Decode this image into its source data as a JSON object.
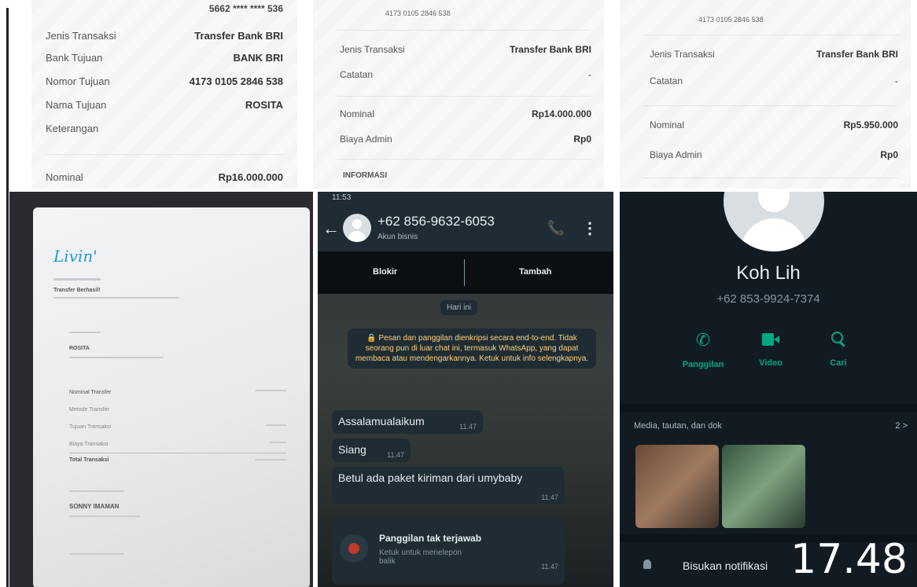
{
  "receipt1": {
    "card_number": "5662 **** **** 536",
    "rows": [
      {
        "label": "Jenis Transaksi",
        "value": "Transfer Bank BRI"
      },
      {
        "label": "Bank Tujuan",
        "value": "BANK BRI"
      },
      {
        "label": "Nomor Tujuan",
        "value": "4173 0105 2846 538"
      },
      {
        "label": "Nama Tujuan",
        "value": "ROSITA"
      },
      {
        "label": "Keterangan",
        "value": ""
      }
    ],
    "nominal_label": "Nominal",
    "nominal_value": "Rp16.000.000"
  },
  "receipt2": {
    "account": "4173 0105 2846 538",
    "jenis_label": "Jenis Transaksi",
    "jenis_value": "Transfer Bank BRI",
    "catatan_label": "Catatan",
    "catatan_value": "-",
    "nominal_label": "Nominal",
    "nominal_value": "Rp14.000.000",
    "admin_label": "Biaya Admin",
    "admin_value": "Rp0",
    "info_label": "INFORMASI"
  },
  "receipt3": {
    "account": "4173 0105 2846 538",
    "jenis_label": "Jenis Transaksi",
    "jenis_value": "Transfer Bank BRI",
    "catatan_label": "Catatan",
    "catatan_value": "-",
    "nominal_label": "Nominal",
    "nominal_value": "Rp5.950.000",
    "admin_label": "Biaya Admin",
    "admin_value": "Rp0"
  },
  "photo": {
    "app_logo": "Livin'",
    "status": "Transfer Berhasil!",
    "recipient": "ROSITA",
    "items": [
      "Nominal Transfer",
      "Metode Transfer",
      "Tujuan Transaksi",
      "Biaya Transaksi",
      "Total Transaksi"
    ],
    "source_name": "SONNY IMAMAN"
  },
  "chat": {
    "status_time": "11:53",
    "phone": "+62 856-9632-6053",
    "subtitle": "Akun bisnis",
    "block_label": "Blokir",
    "add_label": "Tambah",
    "date_chip": "Hari ini",
    "encryption_notice": "🔒 Pesan dan panggilan dienkripsi secara end-to-end. Tidak seorang pun di luar chat ini, termasuk WhatsApp, yang dapat membaca atau mendengarkannya. Ketuk untuk info selengkapnya.",
    "messages": [
      {
        "text": "Assalamualaikum",
        "time": "11.47"
      },
      {
        "text": "Siang",
        "time": "11.47"
      },
      {
        "text": "Betul ada paket kiriman dari umybaby",
        "time": "11.47"
      }
    ],
    "missed_call_title": "Panggilan tak terjawab",
    "missed_call_sub": "Ketuk untuk menelepon balik",
    "missed_call_time": "11.47"
  },
  "contact": {
    "name": "Koh Lih",
    "phone": "+62 853-9924-7374",
    "actions": [
      {
        "label": "Panggilan",
        "icon": "phone-icon"
      },
      {
        "label": "Video",
        "icon": "video-icon"
      },
      {
        "label": "Cari",
        "icon": "search-icon"
      }
    ],
    "media_label": "Media, tautan, dan dok",
    "media_count": "2 >",
    "mute_label": "Bisukan notifikasi"
  },
  "overlay_time": "17.48",
  "colors": {
    "whatsapp_green": "#00a884",
    "dark_bg": "#121b22",
    "receipt_bg": "#f7f8fa"
  }
}
